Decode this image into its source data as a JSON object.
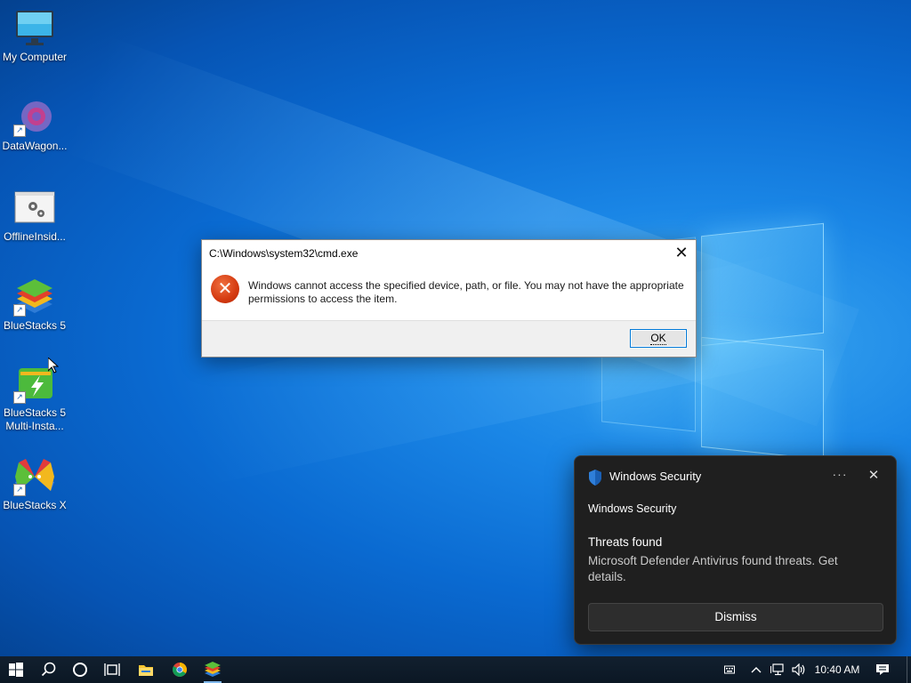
{
  "desktop": {
    "icons": [
      {
        "label": "My Computer"
      },
      {
        "label": "DataWagon..."
      },
      {
        "label": "OfflineInsid..."
      },
      {
        "label": "BlueStacks 5"
      },
      {
        "label": "BlueStacks 5 Multi-Insta..."
      },
      {
        "label": "BlueStacks X"
      }
    ]
  },
  "dialog": {
    "title": "C:\\Windows\\system32\\cmd.exe",
    "icon": "error-icon",
    "message": "Windows cannot access the specified device, path, or file. You may not have the appropriate permissions to access the item.",
    "ok_label": "OK",
    "close_glyph": "✕"
  },
  "toast": {
    "app_name": "Windows Security",
    "attribution": "Windows Security",
    "heading": "Threats found",
    "body": "Microsoft Defender Antivirus found threats. Get details.",
    "dismiss_label": "Dismiss",
    "more_glyph": "···",
    "close_glyph": "✕"
  },
  "taskbar": {
    "clock": "10:40 AM",
    "items": [
      "start-icon",
      "search-icon",
      "cortana-icon",
      "task-view-icon",
      "file-explorer-icon",
      "chrome-icon",
      "bluestacks-icon"
    ],
    "tray": [
      "keyboard-icon",
      "chevron-up-icon",
      "network-icon",
      "volume-icon",
      "notification-icon"
    ]
  },
  "colors": {
    "accent": "#0078d7",
    "error_red": "#d43a10",
    "toast_bg": "#1f1f1f",
    "taskbar_bg": "#0b1724"
  }
}
